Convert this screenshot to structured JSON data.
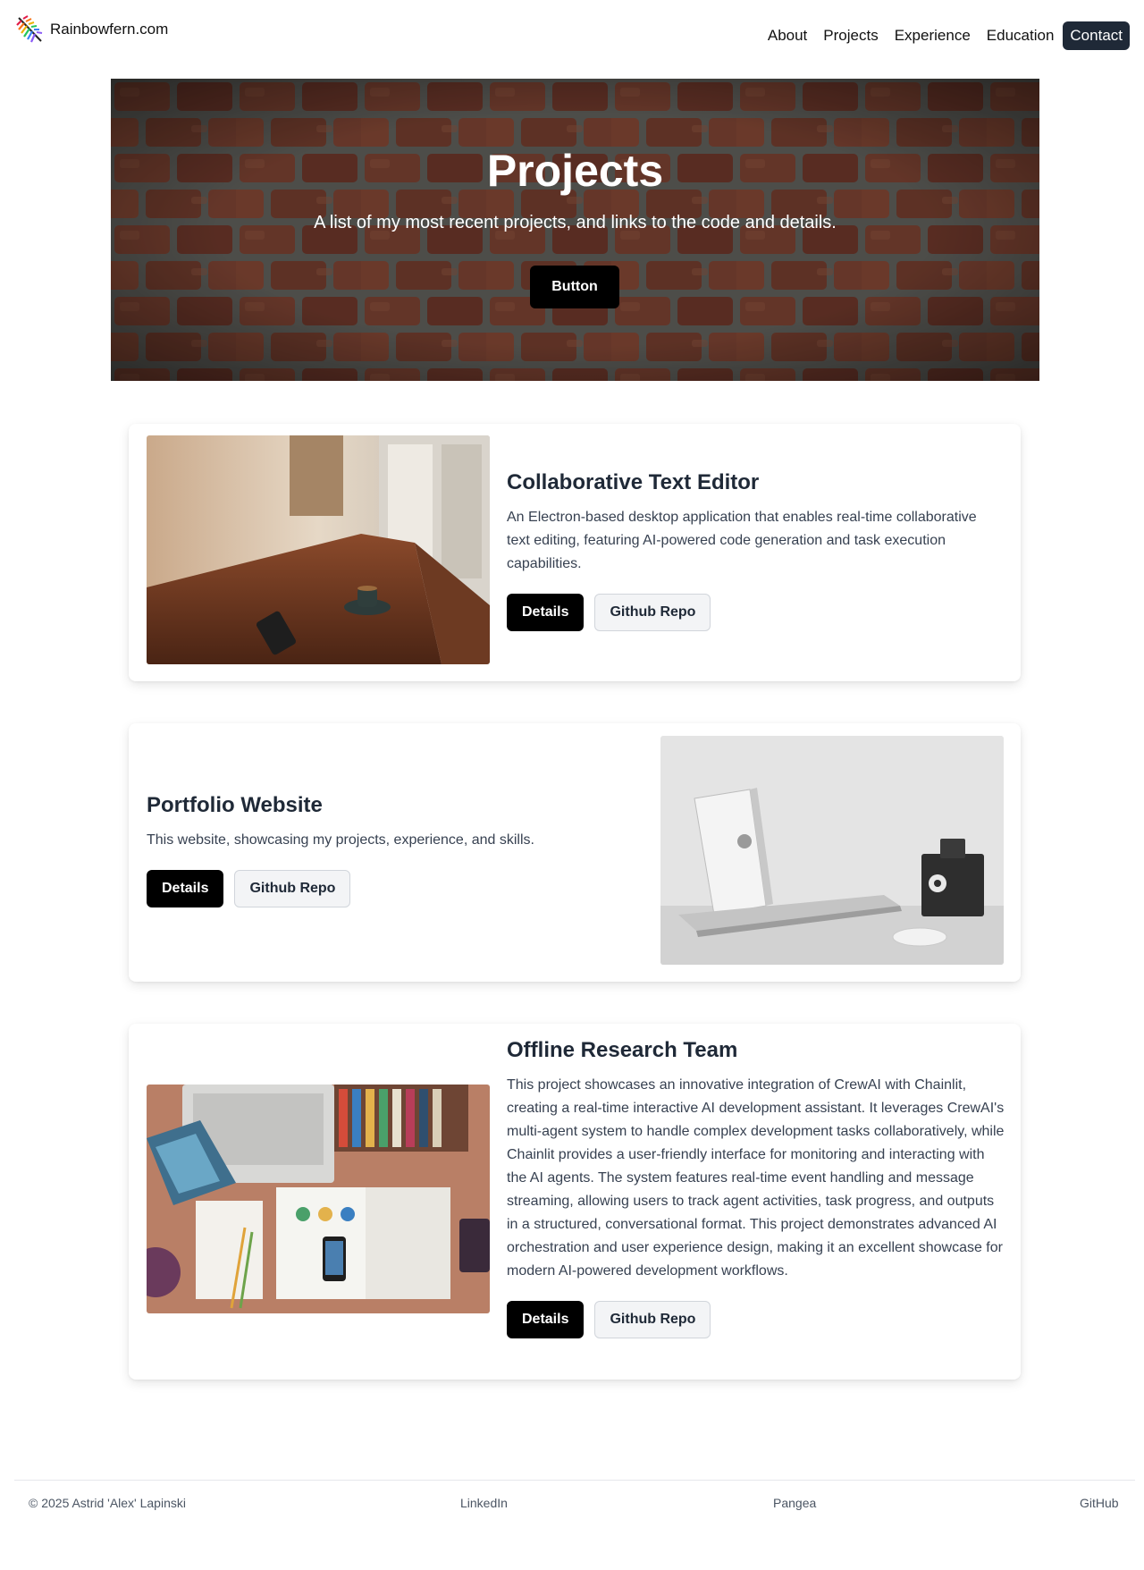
{
  "brand": {
    "name": "Rainbowfern.com"
  },
  "nav": {
    "items": [
      {
        "label": "About"
      },
      {
        "label": "Projects"
      },
      {
        "label": "Experience"
      },
      {
        "label": "Education"
      },
      {
        "label": "Contact"
      }
    ],
    "active_color": "#1f2937"
  },
  "hero": {
    "title": "Projects",
    "subtitle": "A list of my most recent projects, and links to the code and details.",
    "button_label": "Button"
  },
  "projects": [
    {
      "title": "Collaborative Text Editor",
      "description": "An Electron-based desktop application that enables real-time collaborative text editing, featuring AI-powered code generation and task execution capabilities.",
      "details_label": "Details",
      "repo_label": "Github Repo",
      "image": "cafe-table-photo"
    },
    {
      "title": "Portfolio Website",
      "description": "This website, showcasing my projects, experience, and skills.",
      "details_label": "Details",
      "repo_label": "Github Repo",
      "image": "laptop-desk-photo"
    },
    {
      "title": "Offline Research Team",
      "description": "This project showcases an innovative integration of CrewAI with Chainlit, creating a real-time interactive AI development assistant. It leverages CrewAI's multi-agent system to handle complex development tasks collaboratively, while Chainlit provides a user-friendly interface for monitoring and interacting with the AI agents. The system features real-time event handling and message streaming, allowing users to track agent activities, task progress, and outputs in a structured, conversational format. This project demonstrates advanced AI orchestration and user experience design, making it an excellent showcase for modern AI-powered development workflows.",
      "details_label": "Details",
      "repo_label": "Github Repo",
      "image": "design-desk-photo"
    }
  ],
  "footer": {
    "copyright": "© 2025 Astrid 'Alex' Lapinski",
    "links": [
      {
        "label": "LinkedIn"
      },
      {
        "label": "Pangea"
      },
      {
        "label": "GitHub"
      }
    ]
  }
}
